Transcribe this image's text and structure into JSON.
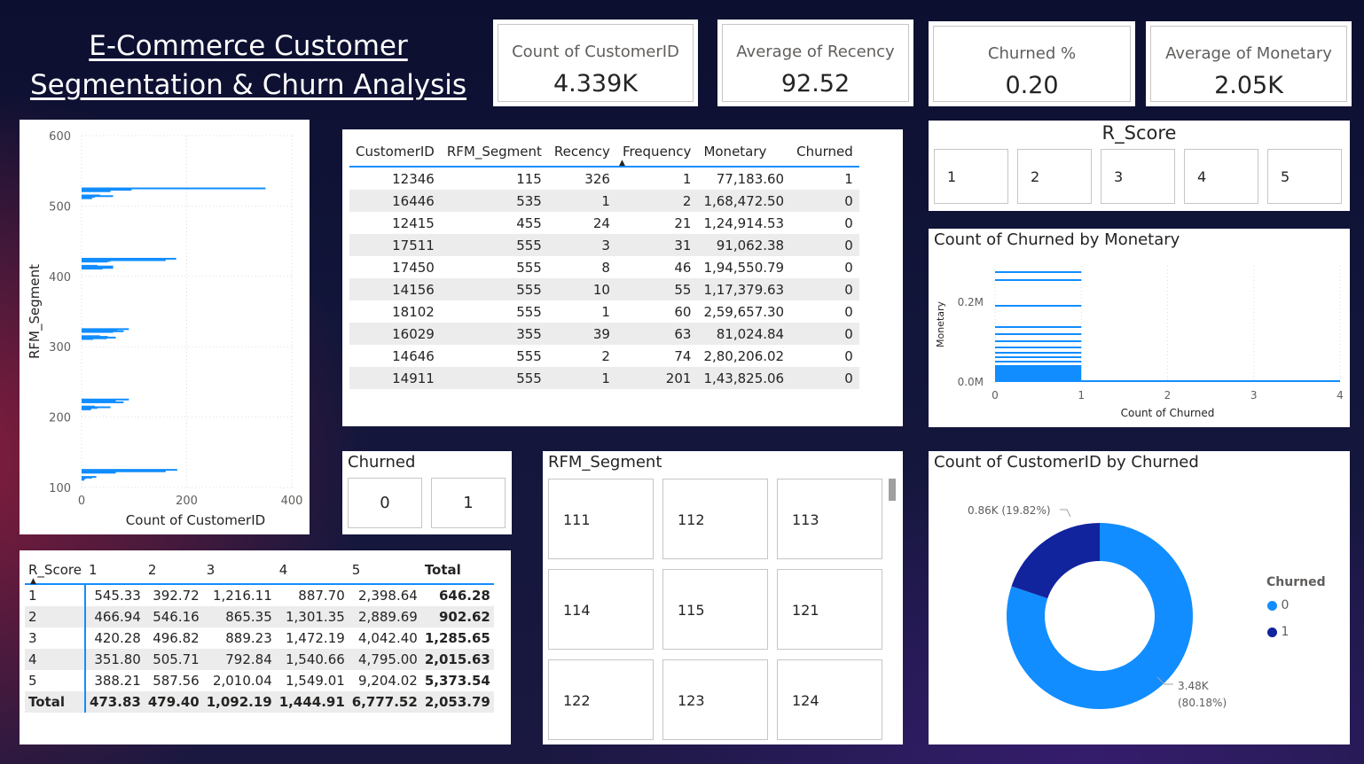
{
  "title": {
    "line1": "E-Commerce Customer",
    "line2": "Segmentation & Churn Analysis"
  },
  "kpis": [
    {
      "label": "Count of CustomerID",
      "value": "4.339K"
    },
    {
      "label": "Average of Recency",
      "value": "92.52"
    },
    {
      "label": "Churned %",
      "value": "0.20"
    },
    {
      "label": "Average of Monetary",
      "value": "2.05K"
    }
  ],
  "rscore_slicer": {
    "title": "R_Score",
    "options": [
      "1",
      "2",
      "3",
      "4",
      "5"
    ]
  },
  "churned_slicer": {
    "title": "Churned",
    "options": [
      "0",
      "1"
    ]
  },
  "segment_slicer": {
    "title": "RFM_Segment",
    "options": [
      "111",
      "112",
      "113",
      "114",
      "115",
      "121",
      "122",
      "123",
      "124"
    ]
  },
  "customer_table": {
    "columns": [
      "CustomerID",
      "RFM_Segment",
      "Recency",
      "Frequency",
      "Monetary",
      "Churned"
    ],
    "rows": [
      [
        "12346",
        "115",
        "326",
        "1",
        "77,183.60",
        "1"
      ],
      [
        "16446",
        "535",
        "1",
        "2",
        "1,68,472.50",
        "0"
      ],
      [
        "12415",
        "455",
        "24",
        "21",
        "1,24,914.53",
        "0"
      ],
      [
        "17511",
        "555",
        "3",
        "31",
        "91,062.38",
        "0"
      ],
      [
        "17450",
        "555",
        "8",
        "46",
        "1,94,550.79",
        "0"
      ],
      [
        "14156",
        "555",
        "10",
        "55",
        "1,17,379.63",
        "0"
      ],
      [
        "18102",
        "555",
        "1",
        "60",
        "2,59,657.30",
        "0"
      ],
      [
        "16029",
        "355",
        "39",
        "63",
        "81,024.84",
        "0"
      ],
      [
        "14646",
        "555",
        "2",
        "74",
        "2,80,206.02",
        "0"
      ],
      [
        "14911",
        "555",
        "1",
        "201",
        "1,43,825.06",
        "0"
      ]
    ]
  },
  "matrix": {
    "columns": [
      "R_Score",
      "1",
      "2",
      "3",
      "4",
      "5",
      "Total"
    ],
    "rows": [
      [
        "1",
        "545.33",
        "392.72",
        "1,216.11",
        "887.70",
        "2,398.64",
        "646.28"
      ],
      [
        "2",
        "466.94",
        "546.16",
        "865.35",
        "1,301.35",
        "2,889.69",
        "902.62"
      ],
      [
        "3",
        "420.28",
        "496.82",
        "889.23",
        "1,472.19",
        "4,042.40",
        "1,285.65"
      ],
      [
        "4",
        "351.80",
        "505.71",
        "792.84",
        "1,540.66",
        "4,795.00",
        "2,015.63"
      ],
      [
        "5",
        "388.21",
        "587.56",
        "2,010.04",
        "1,549.01",
        "9,204.02",
        "5,373.54"
      ]
    ],
    "total": [
      "Total",
      "473.83",
      "479.40",
      "1,092.19",
      "1,444.91",
      "6,777.52",
      "2,053.79"
    ]
  },
  "chart_data": [
    {
      "type": "bar",
      "orientation": "horizontal",
      "xlabel": "Count of CustomerID",
      "ylabel": "RFM_Segment",
      "xlim": [
        0,
        400
      ],
      "ylim": [
        100,
        600
      ],
      "xticks": [
        "0",
        "200",
        "400"
      ],
      "yticks": [
        "100",
        "200",
        "300",
        "400",
        "500",
        "600"
      ],
      "grid": true,
      "color": "#118DFF",
      "bars": [
        {
          "y": 111,
          "x": 5
        },
        {
          "y": 112,
          "x": 5
        },
        {
          "y": 113,
          "x": 8
        },
        {
          "y": 114,
          "x": 20
        },
        {
          "y": 115,
          "x": 28
        },
        {
          "y": 121,
          "x": 65
        },
        {
          "y": 122,
          "x": 28
        },
        {
          "y": 123,
          "x": 160
        },
        {
          "y": 124,
          "x": 45
        },
        {
          "y": 125,
          "x": 182
        },
        {
          "y": 211,
          "x": 18
        },
        {
          "y": 212,
          "x": 15
        },
        {
          "y": 213,
          "x": 30
        },
        {
          "y": 214,
          "x": 55
        },
        {
          "y": 215,
          "x": 25
        },
        {
          "y": 221,
          "x": 80
        },
        {
          "y": 222,
          "x": 35
        },
        {
          "y": 223,
          "x": 65
        },
        {
          "y": 224,
          "x": 45
        },
        {
          "y": 225,
          "x": 90
        },
        {
          "y": 311,
          "x": 22
        },
        {
          "y": 312,
          "x": 48
        },
        {
          "y": 313,
          "x": 65
        },
        {
          "y": 314,
          "x": 50
        },
        {
          "y": 315,
          "x": 35
        },
        {
          "y": 321,
          "x": 60
        },
        {
          "y": 322,
          "x": 80
        },
        {
          "y": 323,
          "x": 68
        },
        {
          "y": 324,
          "x": 40
        },
        {
          "y": 325,
          "x": 90
        },
        {
          "y": 411,
          "x": 40
        },
        {
          "y": 412,
          "x": 60
        },
        {
          "y": 413,
          "x": 40
        },
        {
          "y": 414,
          "x": 60
        },
        {
          "y": 415,
          "x": 30
        },
        {
          "y": 421,
          "x": 50
        },
        {
          "y": 422,
          "x": 55
        },
        {
          "y": 423,
          "x": 160
        },
        {
          "y": 424,
          "x": 75
        },
        {
          "y": 425,
          "x": 180
        },
        {
          "y": 511,
          "x": 20
        },
        {
          "y": 512,
          "x": 18
        },
        {
          "y": 513,
          "x": 25
        },
        {
          "y": 514,
          "x": 60
        },
        {
          "y": 515,
          "x": 35
        },
        {
          "y": 521,
          "x": 55
        },
        {
          "y": 522,
          "x": 42
        },
        {
          "y": 523,
          "x": 95
        },
        {
          "y": 524,
          "x": 50
        },
        {
          "y": 525,
          "x": 350
        }
      ]
    },
    {
      "type": "bar",
      "title": "Count of Churned by Monetary",
      "xlabel": "Count of Churned",
      "ylabel": "Monetary",
      "xlim": [
        0,
        4
      ],
      "xticks": [
        "0",
        "1",
        "2",
        "3",
        "4"
      ],
      "yticks": [
        "0.0M",
        "0.2M"
      ],
      "color": "#118DFF",
      "note_values": "stacked thin bars from 0 to 1, thin tail to 4"
    },
    {
      "type": "pie",
      "title": "Count of CustomerID by Churned",
      "legend_title": "Churned",
      "legend_position": "right",
      "slices": [
        {
          "name": "0",
          "value": 3.48,
          "label_1": "3.48K",
          "label_2": "(80.18%)",
          "color": "#118DFF"
        },
        {
          "name": "1",
          "value": 0.86,
          "label_1": "0.86K (19.82%)",
          "color": "#12239E"
        }
      ]
    }
  ]
}
